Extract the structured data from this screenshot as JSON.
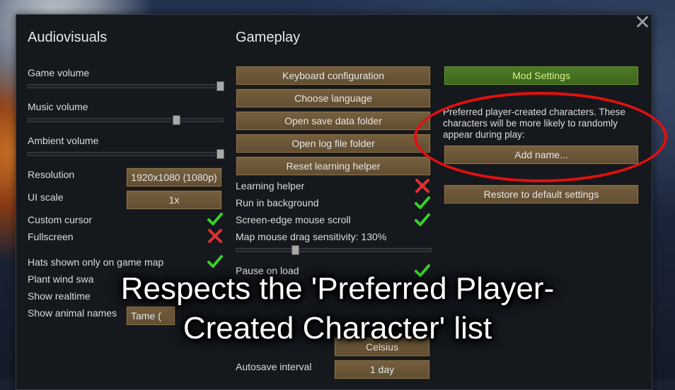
{
  "left": {
    "title": "Audiovisuals",
    "game_volume": "Game volume",
    "music_volume": "Music volume",
    "ambient_volume": "Ambient volume",
    "game_volume_level": 1.0,
    "music_volume_level": 0.75,
    "ambient_volume_level": 1.0,
    "resolution_label": "Resolution",
    "resolution_value": "1920x1080 (1080p)",
    "ui_scale_label": "UI scale",
    "ui_scale_value": "1x",
    "custom_cursor": "Custom cursor",
    "fullscreen": "Fullscreen",
    "hats_label": "Hats shown only on game map",
    "plant_wind_label": "Plant wind swa",
    "show_realtime_label": "Show realtime",
    "show_animal_names_label": "Show animal names",
    "animal_names_value": "Tame ("
  },
  "middle": {
    "title": "Gameplay",
    "buttons": [
      "Keyboard configuration",
      "Choose language",
      "Open save data folder",
      "Open log file folder",
      "Reset learning helper"
    ],
    "learning_helper": "Learning helper",
    "run_in_background": "Run in background",
    "screen_edge_scroll": "Screen-edge mouse scroll",
    "drag_sensitivity": "Map mouse drag sensitivity: 130%",
    "drag_sensitivity_level": 0.3,
    "pause_on_load": "Pause on load",
    "temperature_value": "Celsius",
    "autosave_label": "Autosave interval",
    "autosave_value": "1 day"
  },
  "right": {
    "mod_settings": "Mod Settings",
    "preferred_text": "Preferred player-created characters. These characters will be more likely to randomly appear during play:",
    "add_name": "Add name...",
    "restore_defaults": "Restore to default settings"
  },
  "caption": {
    "line1": "Respects the 'Preferred Player-",
    "line2": "Created Character' list"
  },
  "colors": {
    "check_green": "#3ccf2a",
    "cross_red": "#e03030",
    "highlight_red": "#e01010"
  },
  "icons": {
    "check": "checkmark-icon",
    "cross": "cross-icon",
    "close": "close-icon"
  }
}
